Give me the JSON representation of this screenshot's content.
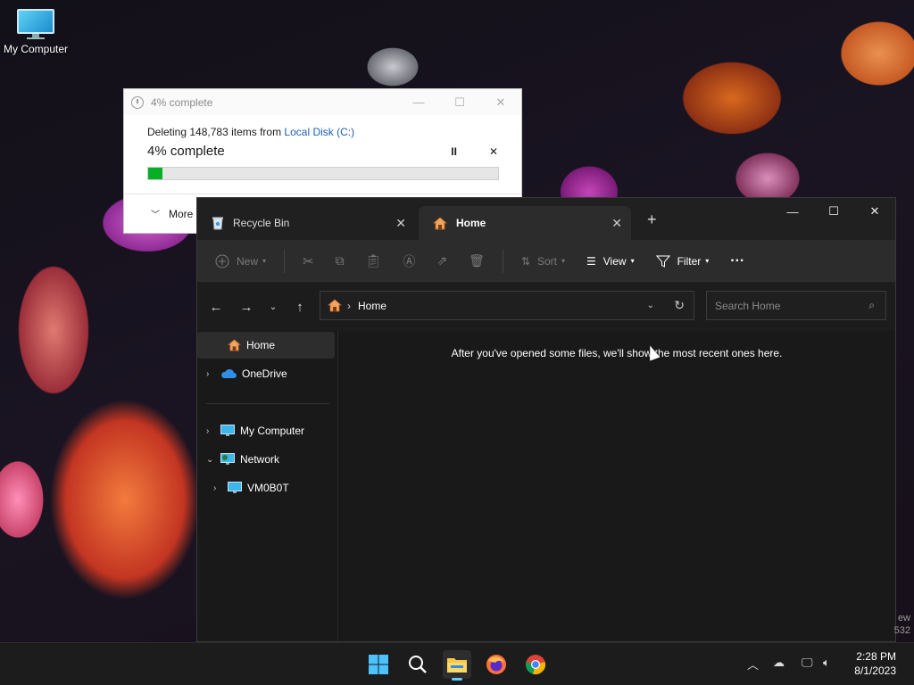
{
  "desktop": {
    "icon_label": "My Computer",
    "watermark_line1": "ew",
    "watermark_line2": "532"
  },
  "progress_dialog": {
    "title": "4% complete",
    "deleting_prefix": "Deleting 148,783 items from ",
    "source_link": "Local Disk (C:)",
    "status": "4% complete",
    "progress_percent": 4,
    "more_label": "More",
    "pause_glyph": "II",
    "close_glyph": "✕"
  },
  "explorer": {
    "tabs": [
      {
        "label": "Recycle Bin",
        "active": false
      },
      {
        "label": "Home",
        "active": true
      }
    ],
    "toolbar": {
      "new_label": "New",
      "sort_label": "Sort",
      "view_label": "View",
      "filter_label": "Filter",
      "more_label": "···"
    },
    "address": {
      "location": "Home"
    },
    "search": {
      "placeholder": "Search Home"
    },
    "sidebar": {
      "items": [
        {
          "label": "Home"
        },
        {
          "label": "OneDrive"
        },
        {
          "label": "My Computer"
        },
        {
          "label": "Network"
        },
        {
          "label": "VM0B0T"
        }
      ]
    },
    "empty_message": "After you've opened some files, we'll show the most recent ones here."
  },
  "taskbar": {
    "time": "2:28 PM",
    "date": "8/1/2023"
  },
  "colors": {
    "progress_fill": "#06b025",
    "link": "#1a5fb4",
    "accent": "#60cdff"
  }
}
